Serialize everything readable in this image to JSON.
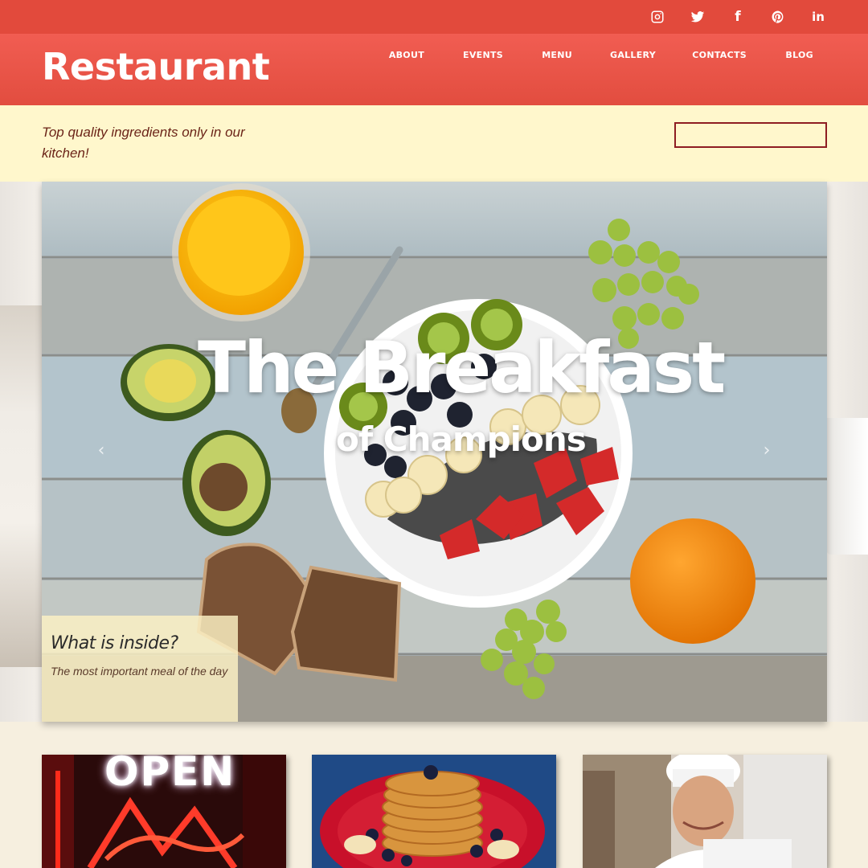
{
  "brand": {
    "name": "Restaurant",
    "accent": "#e24a3c",
    "cream": "#fff7cc"
  },
  "social": [
    {
      "name": "instagram-icon"
    },
    {
      "name": "twitter-icon"
    },
    {
      "name": "facebook-icon",
      "glyph": "f"
    },
    {
      "name": "pinterest-icon"
    },
    {
      "name": "linkedin-icon",
      "glyph": "in"
    }
  ],
  "nav": [
    "ABOUT",
    "EVENTS",
    "MENU",
    "GALLERY",
    "CONTACTS",
    "BLOG"
  ],
  "tagline": "Top quality ingredients only in our kitchen!",
  "search": {
    "value": "",
    "placeholder": ""
  },
  "hero": {
    "title": "The Breakfast",
    "subtitle": "of Champions",
    "prev": "‹",
    "next": "›",
    "caption_title": "What is inside?",
    "caption_text": "The most important meal of the day"
  },
  "cards": {
    "neon_sign": "OPEN"
  }
}
